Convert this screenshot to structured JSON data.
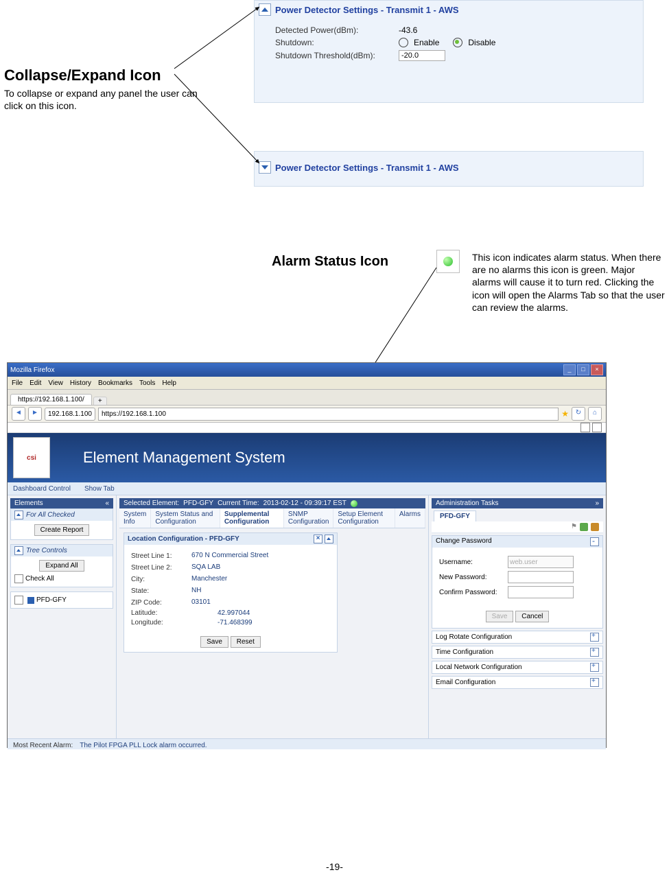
{
  "callouts": {
    "collapse": {
      "heading": "Collapse/Expand Icon",
      "body": "To collapse or expand any panel the user can click on this icon."
    },
    "alarm": {
      "heading": "Alarm Status Icon",
      "body": "This icon indicates alarm status. When there are no alarms this icon is green. Major alarms will cause it to turn red. Clicking the icon will open the  Alarms Tab so that the user can review the alarms."
    }
  },
  "panel1": {
    "title": "Power Detector Settings - Transmit 1 - AWS",
    "detected_lbl": "Detected Power(dBm):",
    "detected_val": "-43.6",
    "shutdown_lbl": "Shutdown:",
    "enable": "Enable",
    "disable": "Disable",
    "threshold_lbl": "Shutdown Threshold(dBm):",
    "threshold_val": "-20.0"
  },
  "panel2": {
    "title": "Power Detector Settings - Transmit 1 - AWS"
  },
  "browser": {
    "window_title": "Mozilla Firefox",
    "menu": {
      "file": "File",
      "edit": "Edit",
      "view": "View",
      "history": "History",
      "bookmarks": "Bookmarks",
      "tools": "Tools",
      "help": "Help"
    },
    "tab": "https://192.168.1.100/",
    "url_prefix": "192.168.1.100",
    "url": "https://192.168.1.100",
    "logo": "csi",
    "ems_title": "Element Management System",
    "dash": {
      "a": "Dashboard Control",
      "b": "Show Tab"
    }
  },
  "left": {
    "elements": "Elements",
    "for_all": "For All Checked",
    "create_report": "Create Report",
    "tree": "Tree Controls",
    "expand_all": "Expand All",
    "check_all": "Check All",
    "node": "PFD-GFY"
  },
  "mid": {
    "headline_a": "Selected Element:",
    "headline_b": "PFD-GFY",
    "headline_c": "Current Time:",
    "headline_d": "2013-02-12 - 09:39:17 EST",
    "tabs": {
      "t1": "System Info",
      "t2": "System Status and Configuration",
      "t3": "Supplemental Configuration",
      "t4": "SNMP Configuration",
      "t5": "Setup Element Configuration",
      "t6": "Alarms"
    },
    "loc_title": "Location Configuration - PFD-GFY",
    "rows": {
      "l1": "Street Line 1:",
      "v1": "670 N Commercial Street",
      "l2": "Street Line 2:",
      "v2": "SQA LAB",
      "l3": "City:",
      "v3": "Manchester",
      "l4": "State:",
      "v4": "NH",
      "l5": "ZIP Code:",
      "v5": "03101",
      "l6": "Latitude:",
      "v6": "42.997044",
      "l7": "Longitude:",
      "v7": "-71.468399"
    },
    "save": "Save",
    "reset": "Reset"
  },
  "right": {
    "title": "Administration Tasks",
    "tab": "PFD-GFY",
    "chgpw": "Change Password",
    "user_l": "Username:",
    "user_v": "web.user",
    "newpw": "New Password:",
    "conf": "Confirm Password:",
    "save": "Save",
    "cancel": "Cancel",
    "rows": {
      "r1": "Log Rotate Configuration",
      "r2": "Time Configuration",
      "r3": "Local Network Configuration",
      "r4": "Email Configuration"
    }
  },
  "footer": {
    "lbl": "Most Recent Alarm:",
    "val": "The Pilot FPGA PLL Lock alarm occurred."
  },
  "page_number": "-19-"
}
